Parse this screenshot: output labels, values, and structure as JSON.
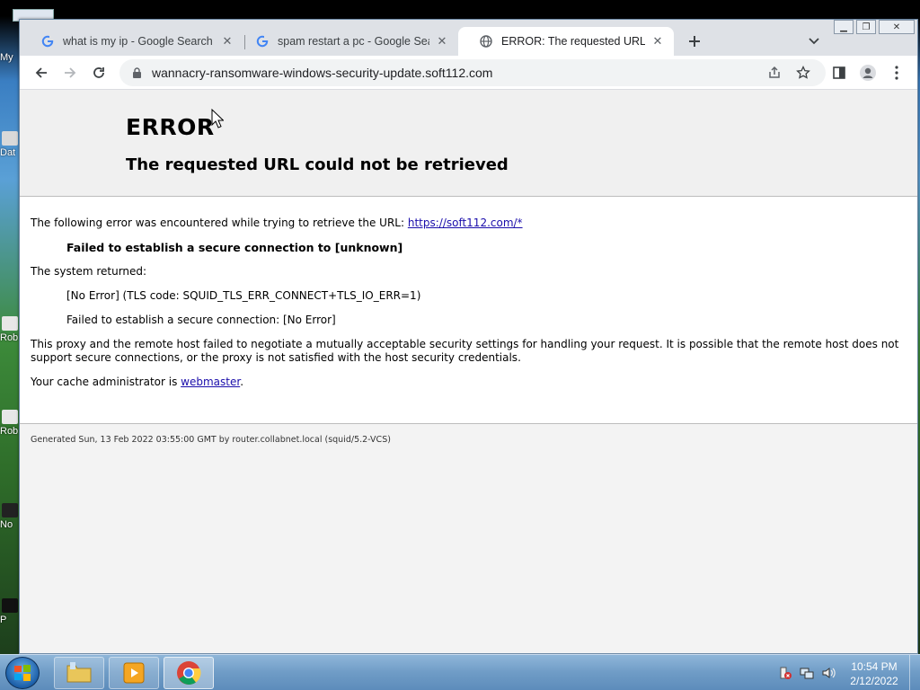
{
  "desktop": {
    "icons": [
      {
        "label": "My"
      },
      {
        "label": "Dat"
      },
      {
        "label": "Rob"
      },
      {
        "label": "Rob"
      },
      {
        "label": "No"
      },
      {
        "label": "P"
      }
    ]
  },
  "browser": {
    "tabs": [
      {
        "title": "what is my ip - Google Search",
        "favicon": "google-g-icon",
        "active": false
      },
      {
        "title": "spam restart a pc - Google Search",
        "favicon": "google-g-icon",
        "active": false
      },
      {
        "title": "ERROR: The requested URL could not be retrieved",
        "favicon": "globe-icon",
        "active": true
      }
    ],
    "address_bar": {
      "url": "wannacry-ransomware-windows-security-update.soft112.com"
    }
  },
  "page": {
    "h1": "ERROR",
    "h2": "The requested URL could not be retrieved",
    "intro_text": "The following error was encountered while trying to retrieve the URL: ",
    "intro_link": "https://soft112.com/*",
    "failure": "Failed to establish a secure connection to [unknown]",
    "system_returned": "The system returned:",
    "tls_code": "[No Error] (TLS code: SQUID_TLS_ERR_CONNECT+TLS_IO_ERR=1)",
    "secure_failed": "Failed to establish a secure connection: [No Error]",
    "proxy_text": "This proxy and the remote host failed to negotiate a mutually acceptable security settings for handling your request. It is possible that the remote host does not support secure connections, or the proxy is not satisfied with the host security credentials.",
    "admin_text": "Your cache administrator is ",
    "admin_link": "webmaster",
    "admin_suffix": ".",
    "footer": "Generated Sun, 13 Feb 2022 03:55:00 GMT by router.collabnet.local (squid/5.2-VCS)"
  },
  "taskbar": {
    "time": "10:54 PM",
    "date": "2/12/2022"
  },
  "colors": {
    "tabstrip": "#dee1e6",
    "link": "#1a0dab",
    "taskbar": "#6f9cc6"
  }
}
